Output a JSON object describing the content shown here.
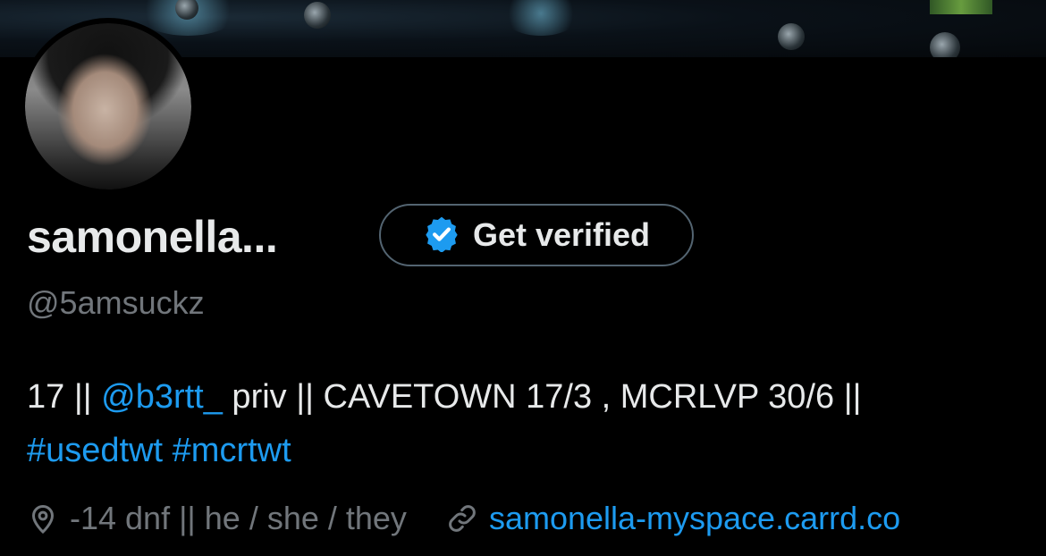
{
  "profile": {
    "display_name": "samonella...",
    "handle": "@5amsuckz",
    "verify_button_label": "Get verified"
  },
  "bio": {
    "part1": "17 || ",
    "mention": "@b3rtt_",
    "part2": " priv || CAVETOWN 17/3 , MCRLVP 30/6 ||",
    "hashtag1": "#usedtwt",
    "hashtag2": "#mcrtwt"
  },
  "meta": {
    "location": "-14 dnf || he / she / they",
    "website": "samonella-myspace.carrd.co"
  },
  "icons": {
    "verify": "verified-badge-icon",
    "location": "location-pin-icon",
    "website": "link-icon"
  },
  "colors": {
    "accent": "#1d9bf0",
    "muted": "#71767b",
    "text": "#e7e9ea",
    "background": "#000000"
  }
}
